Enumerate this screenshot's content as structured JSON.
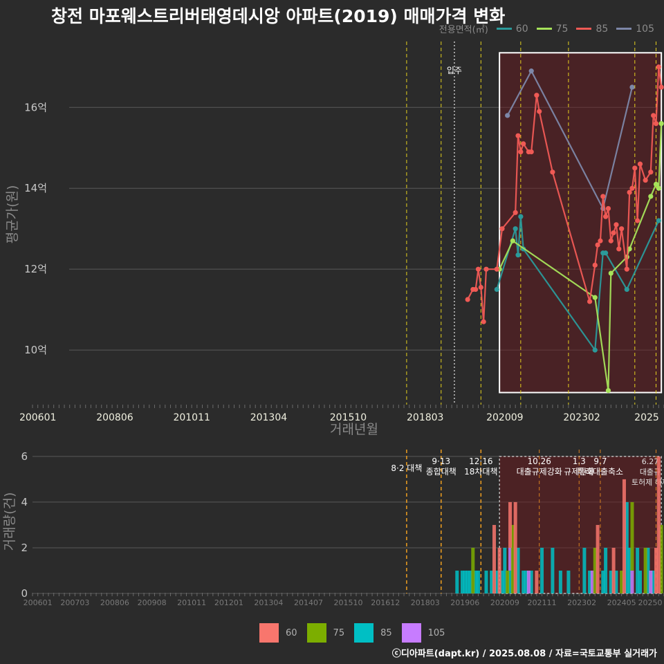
{
  "title": "창전 마포웨스트리버태영데시앙 아파트(2019) 매매가격 변화",
  "credit": "ⓒ디아파트(dapt.kr) / 2025.08.08 / 자료=국토교통부 실거래가",
  "colors": {
    "60": "#f8766d",
    "75": "#7cae00",
    "85": "#00bfc4",
    "105": "#c77cff"
  },
  "line_colors": {
    "60": "#2b9a9a",
    "75": "#a6e35a",
    "85": "#f05a55",
    "105": "#7d87a8"
  },
  "legend_top": {
    "title": "전용면적(㎡)",
    "items": [
      {
        "key": "60",
        "label": "60"
      },
      {
        "key": "75",
        "label": "75"
      },
      {
        "key": "85",
        "label": "85"
      },
      {
        "key": "105",
        "label": "105"
      }
    ]
  },
  "legend_bottom": {
    "items": [
      {
        "key": "60",
        "label": "60"
      },
      {
        "key": "75",
        "label": "75"
      },
      {
        "key": "85",
        "label": "85"
      },
      {
        "key": "105",
        "label": "105"
      }
    ]
  },
  "chart_data": [
    {
      "type": "line",
      "xlabel": "거래년월",
      "ylabel": "평균가(원)",
      "x_ticks": [
        "200601",
        "200806",
        "201011",
        "201304",
        "201510",
        "201803",
        "202009",
        "202302",
        "2025"
      ],
      "y_ticks": [
        "10억",
        "12억",
        "14억",
        "16억"
      ],
      "ylim": [
        8.6,
        17.8
      ],
      "xlim": [
        "2005-11",
        "2025-09"
      ],
      "move_in_label": "입주",
      "move_in": "2019-02",
      "policy_lines": [
        "2017-08",
        "2018-09",
        "2019-12",
        "2021-03",
        "2022-09",
        "2024-10",
        "2025-06"
      ],
      "highlight_box": {
        "from": "2020-07",
        "to": "2025-08",
        "ymin": 8.95,
        "ymax": 17.35
      },
      "series": [
        {
          "name": "60",
          "points": [
            [
              "2020-06",
              11.5
            ],
            [
              "2021-01",
              13.0
            ],
            [
              "2021-02",
              12.35
            ],
            [
              "2021-03",
              13.3
            ],
            [
              "2021-04",
              12.5
            ],
            [
              "2023-07",
              10.0
            ],
            [
              "2023-10",
              12.4
            ],
            [
              "2023-11",
              12.4
            ],
            [
              "2024-07",
              11.5
            ],
            [
              "2025-07",
              13.2
            ]
          ]
        },
        {
          "name": "75",
          "points": [
            [
              "2020-07",
              12.0
            ],
            [
              "2020-12",
              12.7
            ],
            [
              "2023-07",
              11.3
            ],
            [
              "2023-12",
              9.0
            ],
            [
              "2024-01",
              11.9
            ],
            [
              "2024-07",
              12.3
            ],
            [
              "2024-08",
              12.5
            ],
            [
              "2025-04",
              13.8
            ],
            [
              "2025-06",
              14.1
            ],
            [
              "2025-07",
              14.0
            ],
            [
              "2025-08",
              15.6
            ]
          ]
        },
        {
          "name": "85",
          "points": [
            [
              "2019-07",
              11.25
            ],
            [
              "2019-09",
              11.5
            ],
            [
              "2019-10",
              11.5
            ],
            [
              "2019-11",
              12.0
            ],
            [
              "2019-12",
              11.55
            ],
            [
              "2020-01",
              10.7
            ],
            [
              "2020-02",
              12.0
            ],
            [
              "2020-06",
              12.0
            ],
            [
              "2020-08",
              13.0
            ],
            [
              "2021-01",
              13.4
            ],
            [
              "2021-02",
              15.3
            ],
            [
              "2021-03",
              14.9
            ],
            [
              "2021-04",
              15.1
            ],
            [
              "2021-06",
              14.9
            ],
            [
              "2021-07",
              14.9
            ],
            [
              "2021-09",
              16.3
            ],
            [
              "2021-10",
              15.9
            ],
            [
              "2022-03",
              14.4
            ],
            [
              "2023-05",
              11.2
            ],
            [
              "2023-07",
              12.1
            ],
            [
              "2023-08",
              12.6
            ],
            [
              "2023-09",
              12.7
            ],
            [
              "2023-10",
              13.8
            ],
            [
              "2023-11",
              13.3
            ],
            [
              "2023-12",
              13.5
            ],
            [
              "2024-01",
              12.7
            ],
            [
              "2024-02",
              12.9
            ],
            [
              "2024-03",
              13.1
            ],
            [
              "2024-04",
              12.5
            ],
            [
              "2024-05",
              13.0
            ],
            [
              "2024-07",
              12.0
            ],
            [
              "2024-08",
              13.9
            ],
            [
              "2024-09",
              14.0
            ],
            [
              "2024-10",
              14.5
            ],
            [
              "2024-11",
              13.2
            ],
            [
              "2024-12",
              14.6
            ],
            [
              "2025-02",
              14.2
            ],
            [
              "2025-04",
              14.4
            ],
            [
              "2025-05",
              15.8
            ],
            [
              "2025-06",
              15.6
            ],
            [
              "2025-07",
              17.0
            ],
            [
              "2025-08",
              16.5
            ]
          ]
        },
        {
          "name": "105",
          "points": [
            [
              "2020-10",
              15.8
            ],
            [
              "2021-07",
              16.9
            ],
            [
              "2023-10",
              13.5
            ],
            [
              "2024-09",
              16.5
            ]
          ]
        }
      ]
    },
    {
      "type": "bar",
      "ylabel": "거래량(건)",
      "x_ticks": [
        "200601",
        "200703",
        "200806",
        "200908",
        "201011",
        "201201",
        "201304",
        "201407",
        "201510",
        "201612",
        "201803",
        "201906",
        "202009",
        "202111",
        "202302",
        "202405",
        "20250"
      ],
      "y_ticks": [
        "0",
        "2",
        "4",
        "6"
      ],
      "ylim": [
        0,
        6.3
      ],
      "policy_events": [
        {
          "date": "2017-08",
          "label": "8·2 대책"
        },
        {
          "date": "2018-09",
          "label": "9·13"
        },
        {
          "date": "2018-09",
          "label": "종합대책"
        },
        {
          "date": "2019-12",
          "label": "12·16"
        },
        {
          "date": "2019-12",
          "label": "18차대책"
        },
        {
          "date": "2021-10",
          "label": "10.26"
        },
        {
          "date": "2021-10",
          "label": "대출규제강화"
        },
        {
          "date": "2023-01",
          "label": "1.3"
        },
        {
          "date": "2023-01",
          "label": "규제완화"
        },
        {
          "date": "2023-09",
          "label": "9.7"
        },
        {
          "date": "2023-09",
          "label": "특례대출축소"
        },
        {
          "date": "2025-06",
          "label": "6.27"
        },
        {
          "date": "2025-06",
          "label": "대출규"
        },
        {
          "date": "2025-06",
          "label": "토허제 해제"
        }
      ],
      "series": [
        {
          "name": "60",
          "months": [
            [
              "2020-05",
              3
            ],
            [
              "2020-07",
              2
            ],
            [
              "2020-11",
              2
            ],
            [
              "2021-01",
              4
            ],
            [
              "2021-09",
              1
            ],
            [
              "2023-08",
              3
            ],
            [
              "2024-02",
              2
            ],
            [
              "2024-06",
              5
            ],
            [
              "2025-06",
              2
            ],
            [
              "2025-07",
              6
            ]
          ]
        },
        {
          "name": "75",
          "months": [
            [
              "2019-09",
              2
            ],
            [
              "2020-10",
              1
            ],
            [
              "2020-12",
              3
            ],
            [
              "2023-07",
              2
            ],
            [
              "2024-05",
              1
            ],
            [
              "2024-09",
              3
            ],
            [
              "2025-02",
              2
            ],
            [
              "2025-08",
              3
            ]
          ]
        },
        {
          "name": "85",
          "months": [
            [
              "2019-03",
              1
            ],
            [
              "2019-05",
              1
            ],
            [
              "2019-06",
              1
            ],
            [
              "2019-07",
              1
            ],
            [
              "2019-08",
              1
            ],
            [
              "2019-10",
              1
            ],
            [
              "2019-11",
              1
            ],
            [
              "2020-02",
              1
            ],
            [
              "2020-04",
              1
            ],
            [
              "2020-06",
              1
            ],
            [
              "2020-08",
              1
            ],
            [
              "2020-09",
              2
            ],
            [
              "2020-11",
              1
            ],
            [
              "2021-02",
              2
            ],
            [
              "2021-04",
              1
            ],
            [
              "2021-05",
              1
            ],
            [
              "2021-07",
              1
            ],
            [
              "2021-11",
              2
            ],
            [
              "2022-03",
              2
            ],
            [
              "2022-06",
              1
            ],
            [
              "2022-09",
              1
            ],
            [
              "2023-03",
              2
            ],
            [
              "2023-05",
              1
            ],
            [
              "2023-10",
              1
            ],
            [
              "2023-11",
              2
            ],
            [
              "2024-01",
              1
            ],
            [
              "2024-03",
              1
            ],
            [
              "2024-07",
              4
            ],
            [
              "2024-08",
              2
            ],
            [
              "2024-11",
              2
            ],
            [
              "2024-12",
              1
            ],
            [
              "2025-03",
              2
            ],
            [
              "2025-05",
              1
            ]
          ]
        },
        {
          "name": "105",
          "months": [
            [
              "2020-11",
              1
            ],
            [
              "2021-06",
              1
            ],
            [
              "2023-06",
              1
            ],
            [
              "2024-09",
              1
            ],
            [
              "2025-04",
              1
            ]
          ]
        }
      ]
    }
  ]
}
